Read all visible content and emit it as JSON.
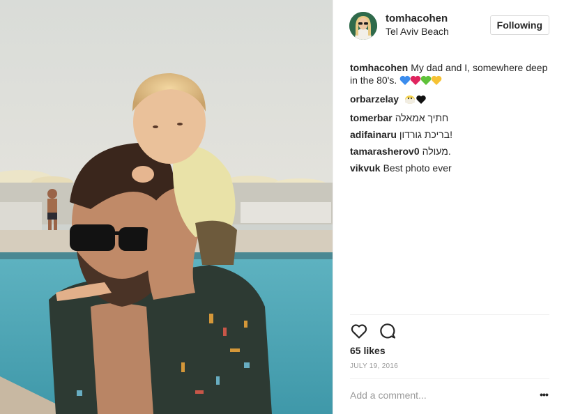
{
  "post": {
    "author": {
      "username": "tomhacohen",
      "location": "Tel Aviv Beach",
      "follow_label": "Following"
    },
    "caption": {
      "username": "tomhacohen",
      "text": "My dad and I, somewhere deep in the 80's."
    },
    "comments": [
      {
        "username": "orbarzelay",
        "text": ""
      },
      {
        "username": "tomerbar",
        "text": "חתיך אמאלה"
      },
      {
        "username": "adifainaru",
        "text": "בריכת גורדון!"
      },
      {
        "username": "tamarasherov0",
        "text": "מעולה."
      },
      {
        "username": "vikvuk",
        "text": "Best photo ever"
      }
    ],
    "likes": "65 likes",
    "date": "July 19, 2016",
    "comment_placeholder": "Add a comment...",
    "more_label": "•••"
  },
  "icons": {
    "like": "heart-icon",
    "comment": "comment-bubble-icon",
    "more": "more-options-icon"
  },
  "colors": {
    "text": "#262626",
    "muted": "#999999",
    "border": "#dbdbdb",
    "heart_blue": "#3b8ced",
    "heart_red": "#e0245e",
    "heart_green": "#5fc23a",
    "heart_yellow": "#f6c234"
  }
}
